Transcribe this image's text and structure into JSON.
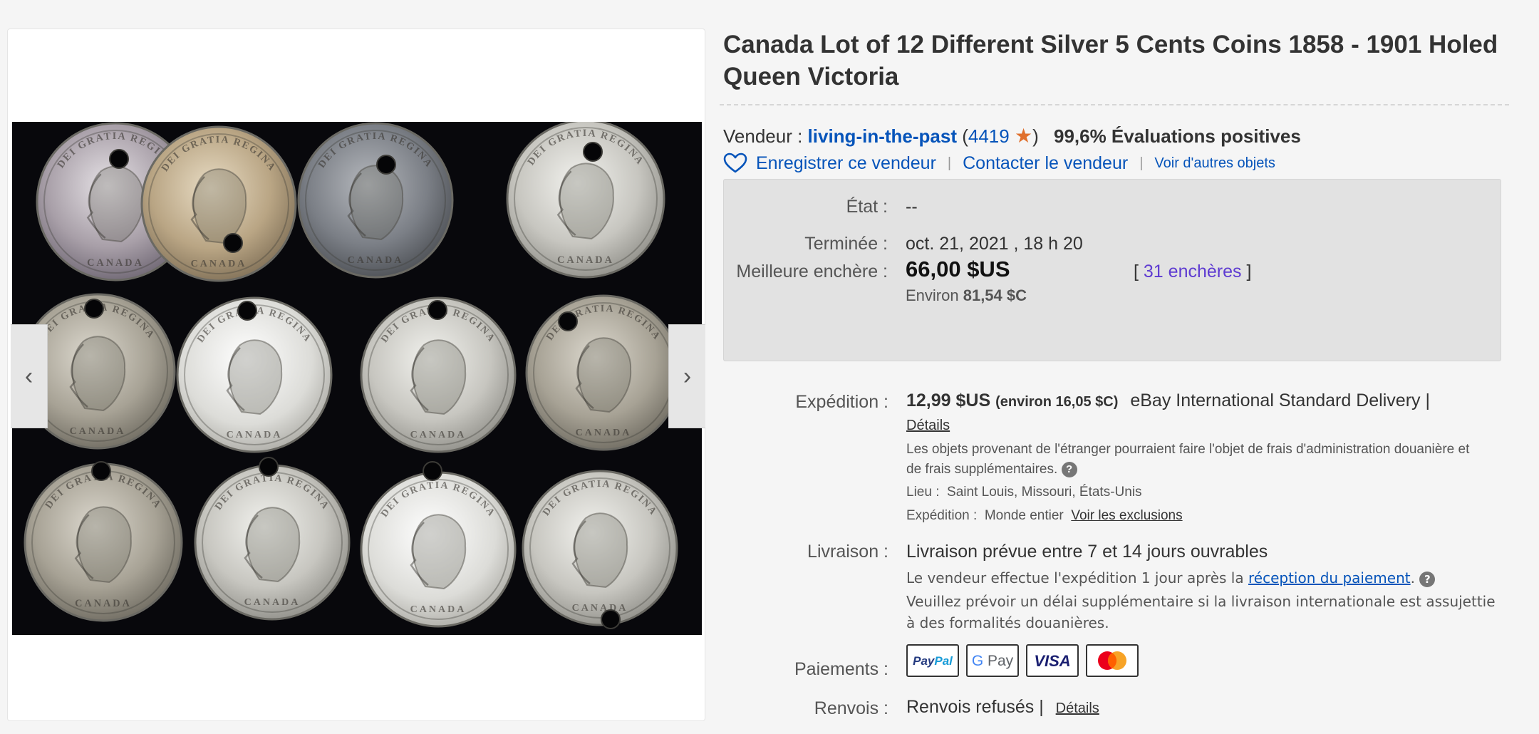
{
  "listing": {
    "title": "Canada Lot of 12 Different Silver 5 Cents Coins 1858 - 1901 Holed Queen Victoria"
  },
  "gallery": {
    "prev_icon": "chevron-left-icon",
    "next_icon": "chevron-right-icon",
    "coin_inscriptions": {
      "top": "DEI GRATIA REGINA",
      "bottom": "CANADA"
    }
  },
  "seller": {
    "label": "Vendeur :",
    "name": "living-in-the-past",
    "open_paren": "(",
    "feedback_count": "4419",
    "close_paren": ")",
    "star_icon": "star-icon",
    "positive_feedback": "99,6% Évaluations positives",
    "save_label": "Enregistrer ce vendeur",
    "sep": "|",
    "contact_label": "Contacter le vendeur",
    "other_items_label": "Voir d'autres objets"
  },
  "status": {
    "condition_label": "État :",
    "condition_value": "--",
    "ended_label": "Terminée :",
    "ended_value": "oct. 21, 2021 , 18 h 20",
    "best_bid_label": "Meilleure enchère :",
    "best_bid_value": "66,00 $US",
    "approx_prefix": "Environ",
    "approx_value": "81,54 $C",
    "bids_open": "[",
    "bids_link": "31 enchères",
    "bids_close": "]"
  },
  "shipping": {
    "label": "Expédition :",
    "price": "12,99 $US",
    "price_approx": "(environ 16,05 $C)",
    "service": "eBay International Standard Delivery |",
    "details_link": "Détails",
    "customs_note": "Les objets provenant de l'étranger pourraient faire l'objet de frais d'administration douanière et de frais supplémentaires.",
    "location_label": "Lieu :",
    "location_value": "Saint Louis, Missouri, États-Unis",
    "ships_to_label": "Expédition :",
    "ships_to_value": "Monde entier",
    "exclusions_link": "Voir les exclusions"
  },
  "delivery": {
    "label": "Livraison :",
    "estimate": "Livraison prévue entre 7 et 14 jours ouvrables",
    "handling_prefix": "Le vendeur effectue l'expédition 1 jour après la",
    "handling_link": "réception du paiement",
    "handling_suffix": ".",
    "intl_note": "Veuillez prévoir un délai supplémentaire si la livraison internationale est assujettie à des formalités douanières."
  },
  "payments": {
    "label": "Paiements :",
    "methods": [
      "PayPal",
      "G Pay",
      "VISA",
      "Mastercard"
    ]
  },
  "returns": {
    "label": "Renvois :",
    "value": "Renvois refusés",
    "sep": "|",
    "details_link": "Détails"
  },
  "colors": {
    "link": "#0654ba",
    "bids": "#5e3bd1",
    "star": "#e0702d",
    "status_bg": "#e2e2e2"
  }
}
